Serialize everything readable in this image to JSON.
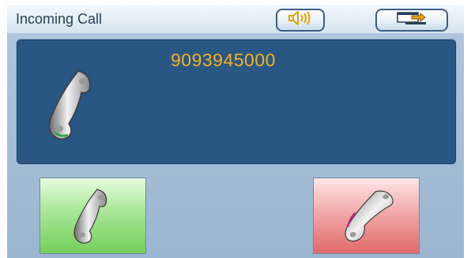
{
  "window": {
    "title": "Incoming Call"
  },
  "toolbar": {
    "speaker_icon": "speaker-volume-icon",
    "minimize_icon": "minimize-window-icon"
  },
  "call": {
    "caller_number": "9093945000",
    "status_icon": "phone-handset-icon"
  },
  "actions": {
    "accept_icon": "answer-phone-icon",
    "reject_icon": "hangup-phone-icon"
  },
  "colors": {
    "panel": "#2a5683",
    "caller_text": "#f5b21e",
    "accept": "#8ddc78",
    "reject": "#ea8a8a"
  }
}
